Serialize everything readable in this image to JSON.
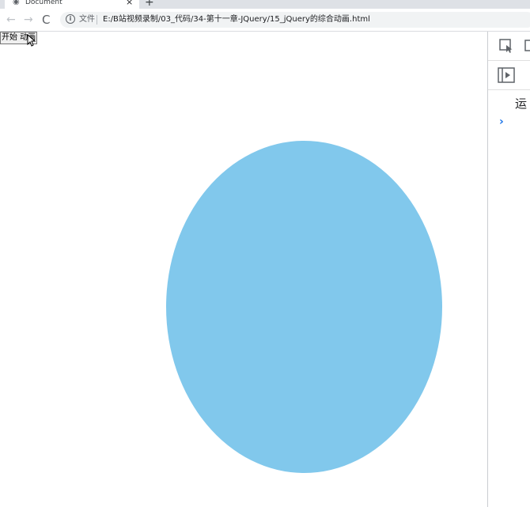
{
  "tab": {
    "title": "Document",
    "close": "×",
    "new_tab": "+"
  },
  "toolbar": {
    "back": "←",
    "forward": "→",
    "reload": "C",
    "scheme_label": "文件",
    "url": "E:/B站视频录制/03_代码/34-第十一章-JQuery/15_jQuery的综合动画.html"
  },
  "page": {
    "button_label": "开始 动画",
    "ellipse_color": "#81c8ec"
  },
  "devtools": {
    "console_text": "运",
    "prompt": "›"
  }
}
